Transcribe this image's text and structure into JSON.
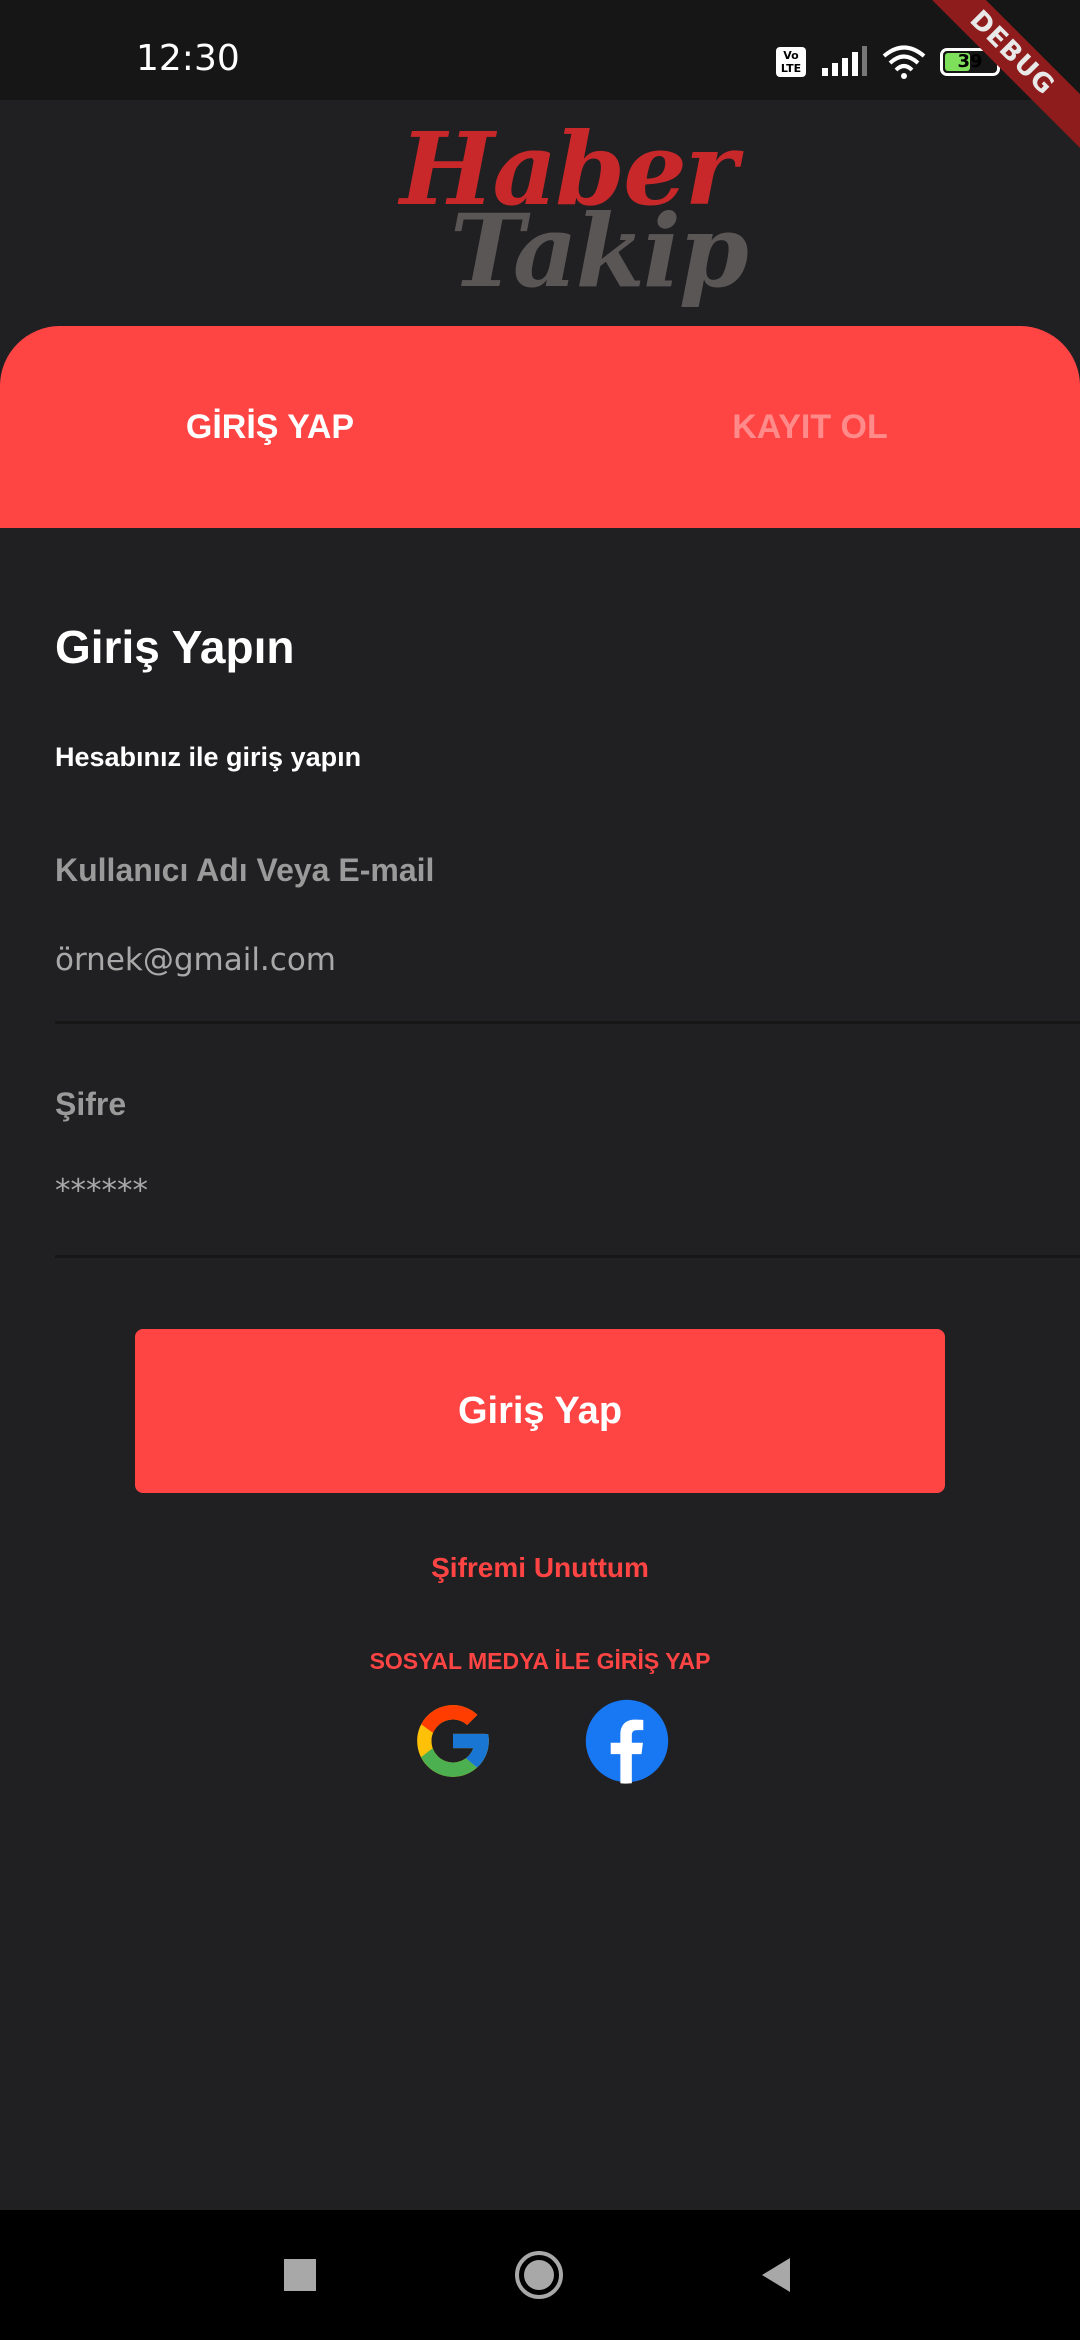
{
  "status_bar": {
    "time": "12:30",
    "volte": "Vo LTE",
    "battery_level": "39",
    "debug_banner": "DEBUG"
  },
  "logo": {
    "line1": "Haber",
    "line2": "Takip",
    "line1_color": "#c8282a",
    "line2_color": "#5b5656"
  },
  "tabs": [
    {
      "label": "GİRİŞ YAP",
      "active": true
    },
    {
      "label": "KAYIT OL",
      "active": false
    }
  ],
  "form": {
    "title": "Giriş Yapın",
    "subtitle": "Hesabınız ile giriş yapın",
    "username_label": "Kullanıcı Adı Veya E-mail",
    "username_placeholder": "örnek@gmail.com",
    "password_label": "Şifre",
    "password_placeholder": "******",
    "submit_label": "Giriş Yap",
    "forgot_label": "Şifremi Unuttum",
    "social_title": "SOSYAL MEDYA İLE GİRİŞ YAP",
    "social_icons": [
      "google-icon",
      "facebook-icon"
    ]
  },
  "colors": {
    "accent": "#ff4444",
    "background": "#202022"
  },
  "nav_bar": {
    "icons": [
      "recents-square-icon",
      "home-circle-icon",
      "back-triangle-icon"
    ]
  }
}
